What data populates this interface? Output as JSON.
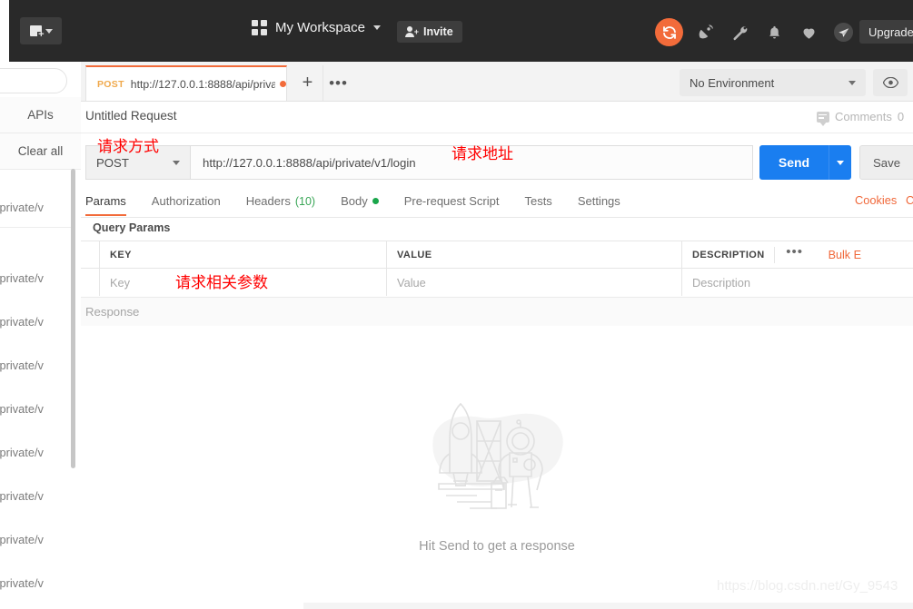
{
  "topbar": {
    "new_button": "new-item",
    "workspace_label": "My Workspace",
    "invite_label": "Invite",
    "upgrade_label": "Upgrade",
    "icons": [
      "sync-icon",
      "satellite-dish-icon",
      "wrench-icon",
      "bell-icon",
      "heart-icon",
      "rocket-plane-icon"
    ],
    "accent_orange": "#f26b3a",
    "background": "#292929"
  },
  "sidebar": {
    "search_placeholder": "",
    "apis_label": "APIs",
    "clear_all_label": "Clear all",
    "history_items": [
      {
        "label": "/private/v"
      },
      {
        "label": "/private/v"
      },
      {
        "label": "/private/v"
      },
      {
        "label": "/private/v"
      },
      {
        "label": "/private/v"
      },
      {
        "label": "/private/v"
      },
      {
        "label": "/private/v"
      },
      {
        "label": "/private/v"
      },
      {
        "label": "/private/v"
      }
    ]
  },
  "tabstrip": {
    "request_tab": {
      "method": "POST",
      "url": "http://127.0.0.1:8888/api/priva…",
      "unsaved": true
    },
    "add_tab_label": "+",
    "more_tabs_label": "•••",
    "environment": "No Environment",
    "eye_icon": "eye-icon"
  },
  "request": {
    "title": "Untitled Request",
    "comments_label": "Comments",
    "comments_count": "0",
    "method": "POST",
    "url": "http://127.0.0.1:8888/api/private/v1/login",
    "send_label": "Send",
    "save_label": "Save"
  },
  "subtabs": [
    {
      "label": "Params",
      "active": true,
      "count": "",
      "dot": false
    },
    {
      "label": "Authorization",
      "active": false,
      "count": "",
      "dot": false
    },
    {
      "label": "Headers",
      "active": false,
      "count": "(10)",
      "dot": false
    },
    {
      "label": "Body",
      "active": false,
      "count": "",
      "dot": true
    },
    {
      "label": "Pre-request Script",
      "active": false,
      "count": "",
      "dot": false
    },
    {
      "label": "Tests",
      "active": false,
      "count": "",
      "dot": false
    },
    {
      "label": "Settings",
      "active": false,
      "count": "",
      "dot": false
    }
  ],
  "links": {
    "cookies": "Cookies",
    "code": "C"
  },
  "params": {
    "section_label": "Query Params",
    "headers": [
      "KEY",
      "VALUE",
      "DESCRIPTION"
    ],
    "row_placeholders": [
      "Key",
      "Value",
      "Description"
    ],
    "more_label": "•••",
    "bulk_edit_label": "Bulk E"
  },
  "response": {
    "label": "Response",
    "empty_text": "Hit Send to get a response",
    "illustration": "rocket-astronaut-illustration"
  },
  "annotations": [
    {
      "id": "anno-method",
      "text": "请求方式"
    },
    {
      "id": "anno-url",
      "text": "请求地址"
    },
    {
      "id": "anno-params",
      "text": "请求相关参数"
    }
  ],
  "watermark": "https://blog.csdn.net/Gy_9543"
}
